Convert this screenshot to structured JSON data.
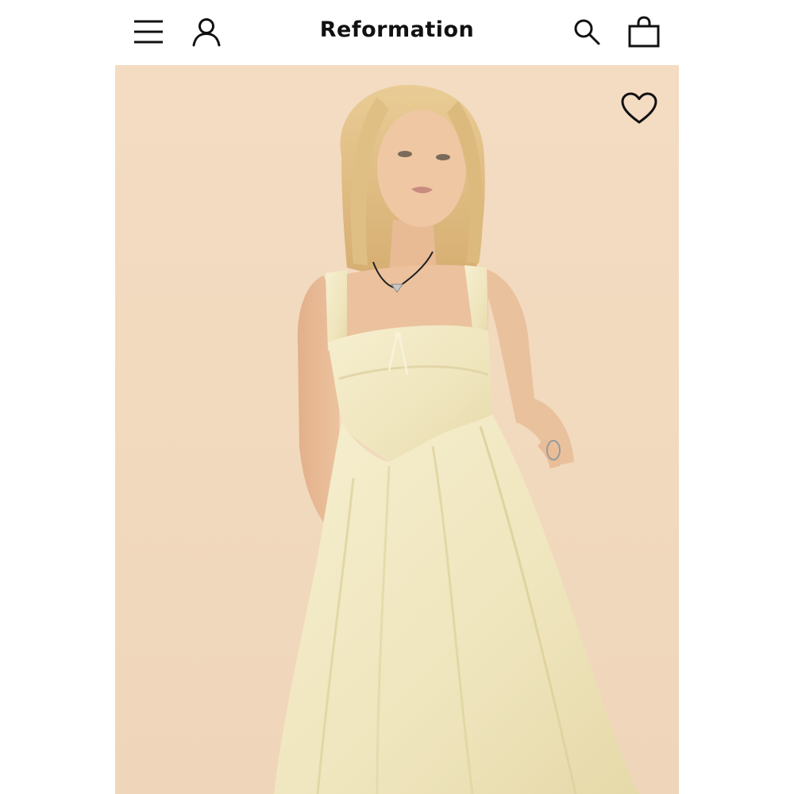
{
  "header": {
    "brand": "Reformation",
    "icons": {
      "menu": "hamburger-menu-icon",
      "account": "user-icon",
      "search": "search-icon",
      "bag": "shopping-bag-icon"
    }
  },
  "product": {
    "image_subject": "model-in-butter-yellow-linen-midi-dress",
    "wishlist_icon": "heart-outline-icon"
  },
  "colors": {
    "background": "#f2dac0",
    "dress": "#f4ecc8",
    "text": "#111111"
  }
}
